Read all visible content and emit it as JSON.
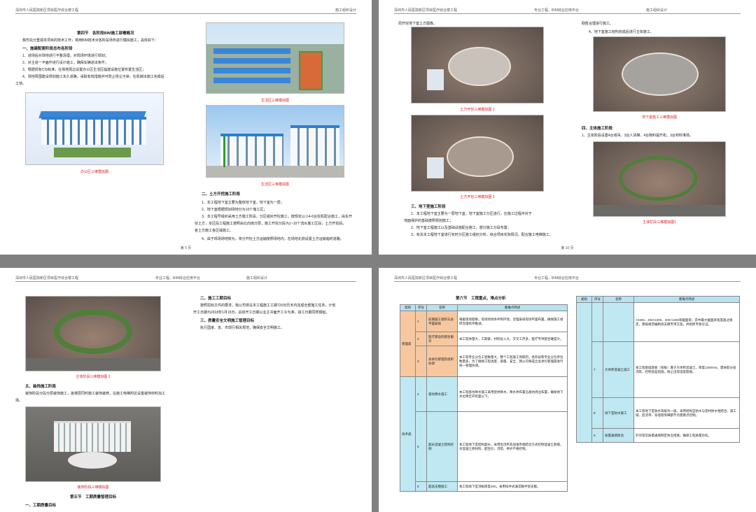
{
  "header": {
    "project": "深圳市人民医院新区项目医疗综合楼工程",
    "center": "施工组织设计",
    "company": "专业工程、BIM综合应用平台"
  },
  "page9": {
    "section_title": "第四节　各阶段BIM施工部署概况",
    "intro": "我司充分重视本项目的技术工作，将用BIM技术对各阶段场布进行模拟施工，具体如下：",
    "h1": "一、施建配套阶段总布各阶段",
    "items": [
      "1、进场后对场地进行平整清理，对现场环境进行规划；",
      "2、对主道一平面作进行设计施工，确保车辆进出条件；",
      "3、根据现有CIS标准，在场地周边设置办公区生活区临建设施位置布置生活区；",
      "4、场地周围建设规划施工永久道路，采取有效措施并可防止扬尘污染，在机械出施工完成后"
    ],
    "items_tail": "工地。",
    "cap_office": "办公区三维模拟图",
    "cap_living": "生活区三维模拟图",
    "cap_living2": "生活区三维模拟图",
    "h2": "二、土方开挖施工阶段",
    "items2": [
      "1、本工程地下室主要为整体地下室，地下室为一层；",
      "2、地下室根据规划场地分为10个施工区；",
      "3、本工程号组织采用土方施工阶段，分区组织开挖施工，按规定以小4-6台挖机配合施工，由东开",
      "挖土方，本区段工程施工按照由北向南分层，施工开挖分段为1~10个流水施工区段，土方开挖段，",
      "各土方施工各区域施工。",
      "4、由于现场场地较为，将分开挖土方运输按照场地内，在场地北侧设置土方运输临时道路。"
    ],
    "footer": "第 9 页"
  },
  "page10": {
    "intro": "而开挖地下室土方图像。",
    "cap1": "土方开挖三维模拟图 1",
    "cap2": "土方开挖三维模拟图 2",
    "h3": "三、地下室施工阶段",
    "items3": [
      "1、本工程地下室主要为一层地下室，地下室施工分区进行，在施工过程中对于",
      "地面保护的基础按照规划施工；",
      "2、地下室工程施工以及基础设施配合施工，部分施工分段布置；",
      "3、有关本工程地下室进行实时分区施工组织分析，综合项目实际情况，配合施工电梯施工。"
    ],
    "right_intro": "取胜合理进行施工。",
    "right_item": "4、地下室施工结构完成后进行主体施工。",
    "cap3": "地下室施工三维模拟图",
    "h4": "四、主体施工阶段",
    "item4": "1、主体阶段设置4台塔吊、3台人货梯、4台物料提升机、3台材料堆场。",
    "cap4": "主体阶段三维模拟图1",
    "footer": "第 10 页"
  },
  "page11": {
    "cap_main2": "主体阶段三维模拟图 2",
    "h5": "五、装饰施工阶段",
    "text5": "装饰阶段分段分层装饰施工，各楼层同时施工装饰装修，在施工电梯附近设置装饰材料加工",
    "text5b": "场。",
    "cap_deco": "装饰阶段三维模拟图",
    "sec5": "第五节　工期质量管理目标",
    "h_q": "一、工期质量目标",
    "h_r1": "二、施工工期目标",
    "r1": [
      "按照招标文件的要求，我公司将在本工程施工工期720日历天内完成全部施工任务，计划",
      "开工日期为2018年1月15日，具体开工日期以业主书面开工令为准，竣工日期同样顺延。"
    ],
    "h_r2": "三、质量安全文明施工管理目标",
    "r2": "执行国家、省、市现行相关规范，确保安全文明施工。"
  },
  "page12": {
    "sec6": "第六节　工程重点、难点分析",
    "table_head": [
      "类别",
      "序号",
      "名称",
      "重难点简述"
    ],
    "cat1": "管理类",
    "cat2": "技术类",
    "rows": [
      {
        "no": "1",
        "name": "前期施工组织与总平面安排",
        "desc": "根据现场勘察，现场场地条件和环境，合理安排现场平面布置，确保施工组织合理有序推进。"
      },
      {
        "no": "2",
        "name": "医疗建设的配合服务",
        "desc": "本工程体量大，工期紧，材料投入大，交叉工序多，医疗专项配合难度大。"
      },
      {
        "no": "3",
        "name": "总承包管理及组织协调",
        "desc": "本工程专业分包工程数量大，整个工程施工周期内，各阶段和专业分包单位数量多，为了确保工程进度、质量、安全，我公司将成立总承包管理部进行统一管理协调。"
      },
      {
        "no": "4",
        "name": "基坑降水施工",
        "desc": "本工程基坑降水施工采用管井降水，降水井布置沿基坑周边布置，确保地下水位降至开挖面以下。"
      },
      {
        "no": "5",
        "name": "超长混凝土结构控制",
        "desc": "本工程地下室结构超长，采用后浇带及加强带相结合方式控制混凝土裂缝，对混凝土原材料、配合比、浇筑、养护严格控制。"
      },
      {
        "no": "6",
        "name": "超高支模施工",
        "desc": "本工程地下室顶板厚度400，采用扣件式满堂脚手架支模。"
      }
    ],
    "table2_head": [
      "类别",
      "序号",
      "名称",
      "重难点简述"
    ],
    "rows2": [
      {
        "no": "",
        "name": "",
        "desc": "×2300、400×2400、300×1200等截面梁，其中最大截面梁宽度超过规定，需按规范编制高支模专项方案，并组织专家论证。"
      },
      {
        "no": "7",
        "name": "大体积混凝土施工",
        "desc": "本工程基础底板（筏板）属于大体积混凝土，厚度1200mm，需采取分层浇筑、控制温差措施，防止出现温度裂缝。"
      },
      {
        "no": "8",
        "name": "地下室防水施工",
        "desc": "本工程地下室防水等级为一级，采用结构自防水与卷材防水相结合，施工缝、后浇带、穿墙管等细部节点需重点控制。"
      },
      {
        "no": "9",
        "name": "质量通病防治",
        "desc": "针对常见质量通病制定防治措施，确保工程质量达标。"
      }
    ]
  }
}
